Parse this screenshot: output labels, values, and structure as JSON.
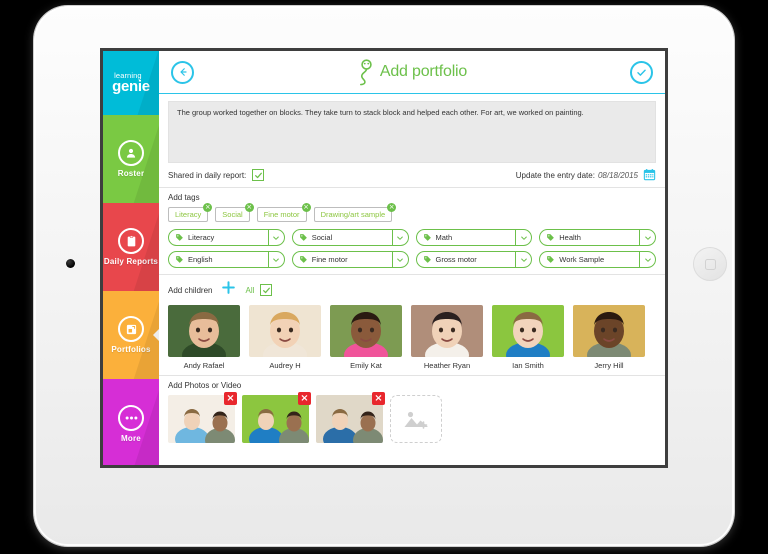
{
  "sidebar": {
    "logo": {
      "line1": "learning",
      "line2": "genie"
    },
    "items": [
      {
        "label": "Roster",
        "icon": "person-icon",
        "color": "#7ac943",
        "active": false
      },
      {
        "label": "Daily Reports",
        "icon": "book-icon",
        "color": "#e8474c",
        "active": false
      },
      {
        "label": "Portfolios",
        "icon": "portfolio-icon",
        "color": "#fbb03b",
        "active": true
      },
      {
        "label": "More",
        "icon": "ellipsis-icon",
        "color": "#d62ed6",
        "active": false
      }
    ]
  },
  "header": {
    "back_icon": "back-arrow-icon",
    "title": "Add portfolio",
    "title_icon": "genie-mascot-icon",
    "confirm_icon": "check-circle-icon",
    "accent": "#2bc4e8",
    "title_color": "#6cc04a"
  },
  "note": {
    "text": "The group worked together on blocks. They take turn to stack block and helped each other. For art, we worked on painting.",
    "shared_label": "Shared in daily report:",
    "shared_checked": true,
    "date_label": "Update the entry date:",
    "date_value": "08/18/2015",
    "calendar_icon": "calendar-icon"
  },
  "tags": {
    "section_label": "Add tags",
    "chips": [
      {
        "label": "Literacy"
      },
      {
        "label": "Social"
      },
      {
        "label": "Fine motor"
      },
      {
        "label": "Drawing/art sample"
      }
    ],
    "dropdowns": [
      {
        "label": "Literacy"
      },
      {
        "label": "Social"
      },
      {
        "label": "Math"
      },
      {
        "label": "Health"
      },
      {
        "label": "English"
      },
      {
        "label": "Fine motor"
      },
      {
        "label": "Gross motor"
      },
      {
        "label": "Work Sample"
      }
    ]
  },
  "children": {
    "section_label": "Add children",
    "add_icon": "plus-icon",
    "all_label": "All",
    "all_checked": true,
    "list": [
      {
        "name": "Andy Rafael",
        "bg": "#4a6b3c",
        "skin": "#e8bd9a",
        "hair": "#8a6a42",
        "shirt": "#2e4a28"
      },
      {
        "name": "Audrey H",
        "bg": "#efe4d2",
        "skin": "#f2d2b6",
        "hair": "#d9a85f",
        "shirt": "#f0e6d8"
      },
      {
        "name": "Emily Kat",
        "bg": "#7d9b52",
        "skin": "#8a5a3b",
        "hair": "#2a1b12",
        "shirt": "#f0549a"
      },
      {
        "name": "Heather Ryan",
        "bg": "#b08e7a",
        "skin": "#f0d2b8",
        "hair": "#2a2020",
        "shirt": "#f4f0ea"
      },
      {
        "name": "Ian Smith",
        "bg": "#8bc63f",
        "skin": "#f2d4bc",
        "hair": "#8a6a42",
        "shirt": "#1f7ec4"
      },
      {
        "name": "Jerry Hill",
        "bg": "#d8b35a",
        "skin": "#6b4428",
        "hair": "#2a1a10",
        "shirt": "#7d8a74"
      }
    ]
  },
  "photos": {
    "section_label": "Add Photos or Video",
    "items": [
      {
        "remove_icon": "close-icon",
        "bg": "#f4eee6",
        "accent": "#6fb7e0"
      },
      {
        "remove_icon": "close-icon",
        "bg": "#8cc63f",
        "accent": "#1f7ec4"
      },
      {
        "remove_icon": "close-icon",
        "bg": "#e0d8c8",
        "accent": "#2b6ea8"
      }
    ],
    "add_placeholder_icon": "image-placeholder-icon"
  }
}
